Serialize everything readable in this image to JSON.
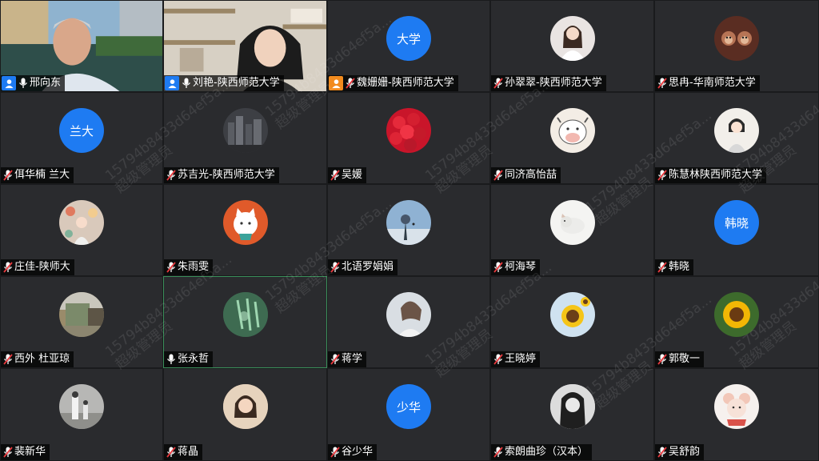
{
  "participants": [
    {
      "name": "邢向东",
      "mic": "on",
      "role": "host",
      "avatar": {
        "type": "video",
        "scene": "man-outdoor"
      }
    },
    {
      "name": "刘艳-陕西师范大学",
      "mic": "on",
      "role": "host",
      "avatar": {
        "type": "video",
        "scene": "woman-shelf"
      }
    },
    {
      "name": "魏姗姗-陕西师范大学",
      "mic": "muted",
      "role": "cohost",
      "avatar": {
        "type": "text",
        "text": "大学"
      }
    },
    {
      "name": "孙翠翠-陕西师范大学",
      "mic": "muted",
      "avatar": {
        "type": "image",
        "art": "girl-white",
        "color": "#e9e4e2"
      }
    },
    {
      "name": "思冉-华南师范大学",
      "mic": "muted",
      "avatar": {
        "type": "image",
        "art": "two-monkeys",
        "color": "#5a2d22"
      }
    },
    {
      "name": "佴华楠 兰大",
      "mic": "muted",
      "avatar": {
        "type": "text",
        "text": "兰大"
      }
    },
    {
      "name": "苏吉光-陕西师范大学",
      "mic": "muted",
      "avatar": {
        "type": "image",
        "art": "city-night",
        "color": "#3d3f44"
      }
    },
    {
      "name": "吴媛",
      "mic": "muted",
      "avatar": {
        "type": "image",
        "art": "red-roses",
        "color": "#c9152a"
      }
    },
    {
      "name": "同济高怡喆",
      "mic": "muted",
      "avatar": {
        "type": "image",
        "art": "cartoon-cow",
        "color": "#f3ede5"
      }
    },
    {
      "name": "陈慧林陕西师范大学",
      "mic": "muted",
      "avatar": {
        "type": "image",
        "art": "cartoon-girl",
        "color": "#f2efea"
      }
    },
    {
      "name": "庄佳-陕师大",
      "mic": "muted",
      "avatar": {
        "type": "image",
        "art": "girl-flowers",
        "color": "#d9c9bb"
      }
    },
    {
      "name": "朱雨雯",
      "mic": "muted",
      "avatar": {
        "type": "image",
        "art": "cat-orange",
        "color": "#e05a2a"
      }
    },
    {
      "name": "北语罗娟娟",
      "mic": "muted",
      "avatar": {
        "type": "image",
        "art": "sky-tree",
        "color": "#8fb2d3"
      }
    },
    {
      "name": "柯海琴",
      "mic": "muted",
      "avatar": {
        "type": "image",
        "art": "white-cat",
        "color": "#f4f4f2"
      }
    },
    {
      "name": "韩晓",
      "mic": "muted",
      "avatar": {
        "type": "text",
        "text": "韩晓"
      }
    },
    {
      "name": "西外 杜亚琼",
      "mic": "muted",
      "avatar": {
        "type": "image",
        "art": "street-photo",
        "color": "#9a8b6a"
      }
    },
    {
      "name": "张永哲",
      "mic": "on",
      "active": true,
      "avatar": {
        "type": "image",
        "art": "green-glass",
        "color": "#2f5b44"
      }
    },
    {
      "name": "蒋学",
      "mic": "muted",
      "avatar": {
        "type": "image",
        "art": "sketch-girl",
        "color": "#d9dee3"
      }
    },
    {
      "name": "王晓婷",
      "mic": "muted",
      "avatar": {
        "type": "image",
        "art": "sunflower-blue",
        "color": "#cfe2f0"
      }
    },
    {
      "name": "郭敬一",
      "mic": "muted",
      "avatar": {
        "type": "image",
        "art": "sunflower-green",
        "color": "#3d6b2c"
      }
    },
    {
      "name": "裴新华",
      "mic": "muted",
      "avatar": {
        "type": "image",
        "art": "people-photo",
        "color": "#b7b7b5"
      }
    },
    {
      "name": "蒋晶",
      "mic": "muted",
      "avatar": {
        "type": "image",
        "art": "girl-selfie",
        "color": "#caa98c"
      }
    },
    {
      "name": "谷少华",
      "mic": "muted",
      "avatar": {
        "type": "text",
        "text": "少华"
      }
    },
    {
      "name": "索朗曲珍（汉本）",
      "mic": "muted",
      "avatar": {
        "type": "image",
        "art": "girl-mono",
        "color": "#c8c8c8"
      }
    },
    {
      "name": "吴舒韵",
      "mic": "muted",
      "avatar": {
        "type": "image",
        "art": "cartoon-mouse",
        "color": "#f6f1ee"
      }
    }
  ],
  "watermark": {
    "line1": "15794b8433d64ef5a...",
    "line2": "超级管理员"
  }
}
